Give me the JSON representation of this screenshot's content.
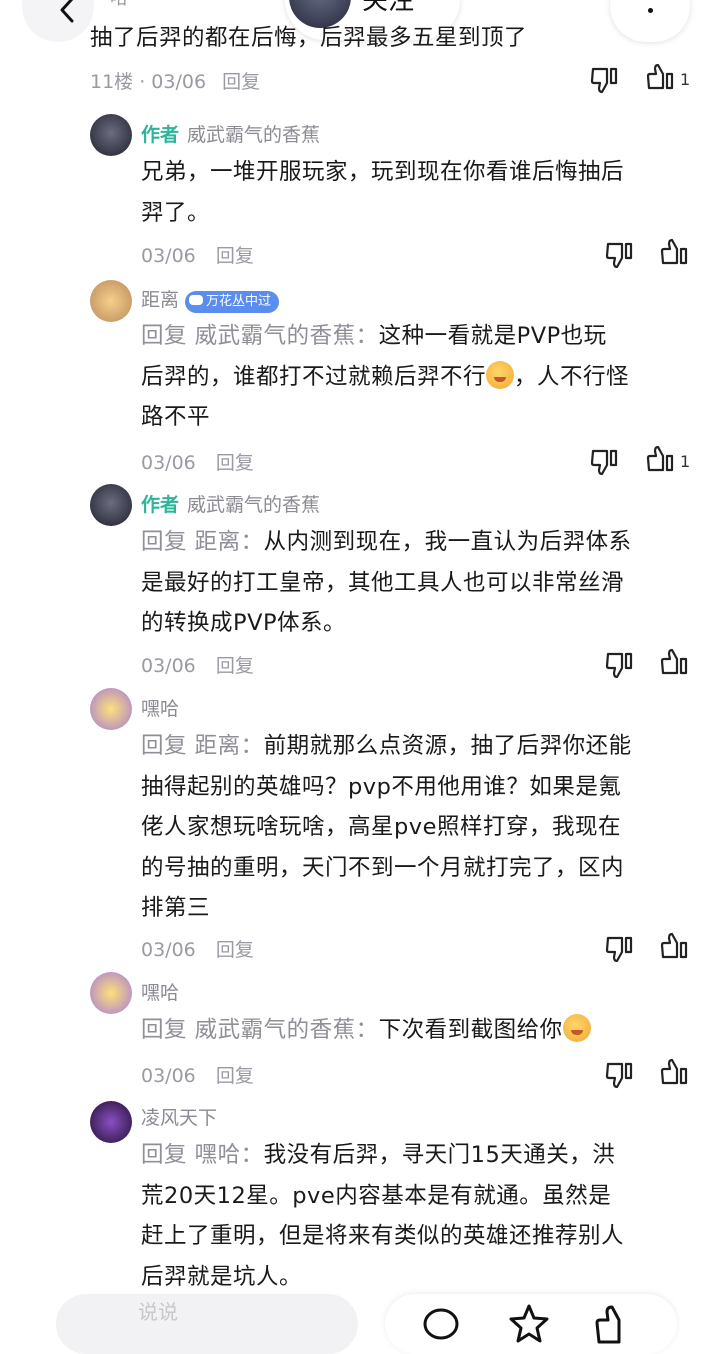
{
  "nav": {
    "back_icon": "chevron-left-icon",
    "poster_name": "哈",
    "follow_label": "关注",
    "more_icon": "more-icon"
  },
  "top_comment": {
    "text": "抽了后羿的都在后悔，后羿最多五星到顶了",
    "meta": "11楼 · 03/06",
    "reply_label": "回复",
    "like_count": "1"
  },
  "replies": [
    {
      "author_tag": "作者",
      "username": "威武霸气的香蕉",
      "text": "兄弟，一堆开服玩家，玩到现在你看谁后悔抽后羿了。",
      "line1": "兄弟，一堆开服玩家，玩到现在你看谁后悔抽后",
      "line2": "羿了。",
      "date": "03/06",
      "reply_label": "回复",
      "like_count": ""
    },
    {
      "username": "距离",
      "badge": "万花丛中过",
      "reply_prefix": "回复 威武霸气的香蕉：",
      "line1": "这种一看就是PVP也玩",
      "line2a": "后羿的，谁都打不过就赖后羿不行",
      "line2b": "，人不行怪",
      "line3": "路不平",
      "date": "03/06",
      "reply_label": "回复",
      "like_count": "1"
    },
    {
      "author_tag": "作者",
      "username": "威武霸气的香蕉",
      "reply_prefix": "回复 距离：",
      "line1": "从内测到现在，我一直认为后羿体系",
      "line2": "是最好的打工皇帝，其他工具人也可以非常丝滑",
      "line3": "的转换成PVP体系。",
      "date": "03/06",
      "reply_label": "回复",
      "like_count": ""
    },
    {
      "username": "嘿哈",
      "reply_prefix": "回复 距离：",
      "line1": "前期就那么点资源，抽了后羿你还能",
      "line2": "抽得起别的英雄吗？pvp不用他用谁？如果是氪",
      "line3": "佬人家想玩啥玩啥，高星pve照样打穿，我现在",
      "line4": "的号抽的重明，天门不到一个月就打完了，区内",
      "line5": "排第三",
      "date": "03/06",
      "reply_label": "回复",
      "like_count": ""
    },
    {
      "username": "嘿哈",
      "reply_prefix": "回复 威武霸气的香蕉：",
      "line1": "下次看到截图给你",
      "date": "03/06",
      "reply_label": "回复",
      "like_count": ""
    },
    {
      "username": "凌风天下",
      "reply_prefix": "回复 嘿哈：",
      "line1": "我没有后羿，寻天门15天通关，洪",
      "line2": "荒20天12星。pve内容基本是有就通。虽然是",
      "line3": "赶上了重明，但是将来有类似的英雄还推荐别人",
      "line4": "后羿就是坑人。",
      "date": "",
      "reply_label": "",
      "like_count": ""
    }
  ],
  "bottom_bar": {
    "input_placeholder": "说说",
    "icons": [
      "comment-icon",
      "star-icon",
      "like-icon"
    ]
  },
  "colors": {
    "author_tag": "#2fb49a",
    "badge": "#5b8def",
    "meta": "#9a9aa2"
  }
}
